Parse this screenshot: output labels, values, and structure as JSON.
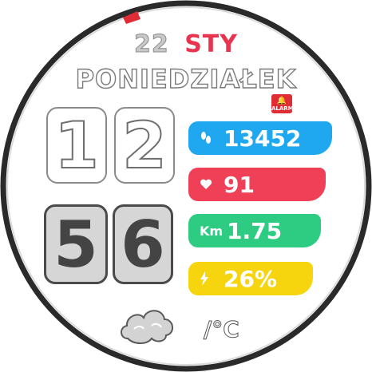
{
  "date": {
    "day": "22",
    "month": "STY"
  },
  "weekday": "PONIEDZIAŁEK",
  "time": {
    "hour_tens": "1",
    "hour_ones": "2",
    "minute_tens": "5",
    "minute_ones": "6"
  },
  "alarm": {
    "label": "ALARM"
  },
  "stats": {
    "steps": {
      "value": "13452",
      "color": "#1fa8f0",
      "icon": "footsteps-icon"
    },
    "heart": {
      "value": "91",
      "color": "#ef4058",
      "icon": "heart-icon"
    },
    "distance": {
      "value": "1.75",
      "unit": "Km",
      "color": "#2ecc82",
      "icon": "distance-icon"
    },
    "battery": {
      "value": "26%",
      "color": "#f7d50e",
      "icon": "lightning-icon"
    }
  },
  "weather": {
    "icon": "cloud-icon",
    "temperature": "/°C"
  },
  "colors": {
    "accent": "#e8344e",
    "bezel": "#1f1f1f"
  }
}
